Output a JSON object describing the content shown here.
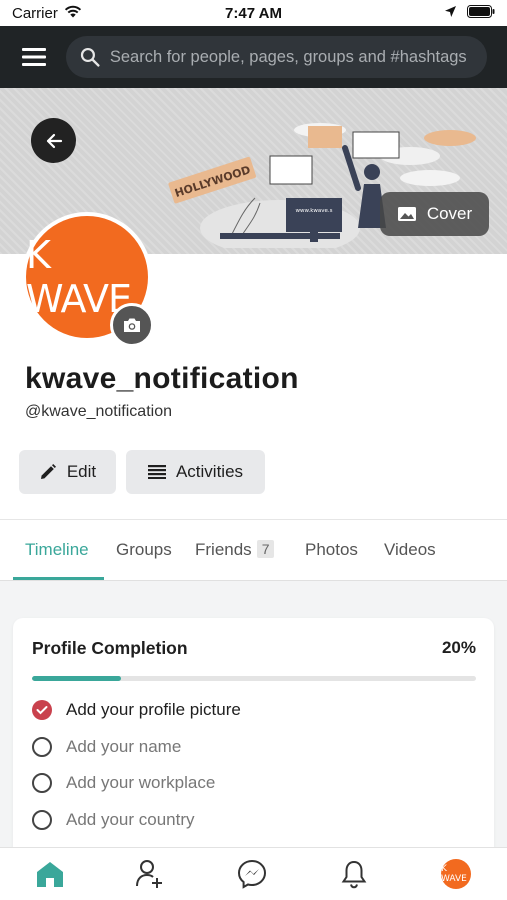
{
  "status_bar": {
    "carrier": "Carrier",
    "time": "7:47 AM"
  },
  "search": {
    "placeholder": "Search for people, pages, groups and #hashtags"
  },
  "cover": {
    "button_label": "Cover",
    "art_sign": "HOLLYWOOD",
    "art_screen_text": "www.kwave.s"
  },
  "profile": {
    "avatar_text": "K WAVE",
    "display_name": "kwave_notification",
    "username": "@kwave_notification",
    "edit_label": "Edit",
    "activities_label": "Activities"
  },
  "tabs": [
    {
      "label": "Timeline",
      "active": true
    },
    {
      "label": "Groups"
    },
    {
      "label": "Friends",
      "badge": "7"
    },
    {
      "label": "Photos"
    },
    {
      "label": "Videos"
    }
  ],
  "completion": {
    "title": "Profile Completion",
    "percent_label": "20%",
    "progress": 0.2,
    "items": [
      {
        "label": "Add your profile picture",
        "done": true
      },
      {
        "label": "Add your name",
        "done": false
      },
      {
        "label": "Add your workplace",
        "done": false
      },
      {
        "label": "Add your country",
        "done": false
      }
    ]
  },
  "bottom_nav": {
    "avatar_text": "K WAVE"
  },
  "colors": {
    "accent": "#3aa79a",
    "brand": "#f26a1f",
    "done": "#c9414d",
    "topbar": "#202426"
  }
}
